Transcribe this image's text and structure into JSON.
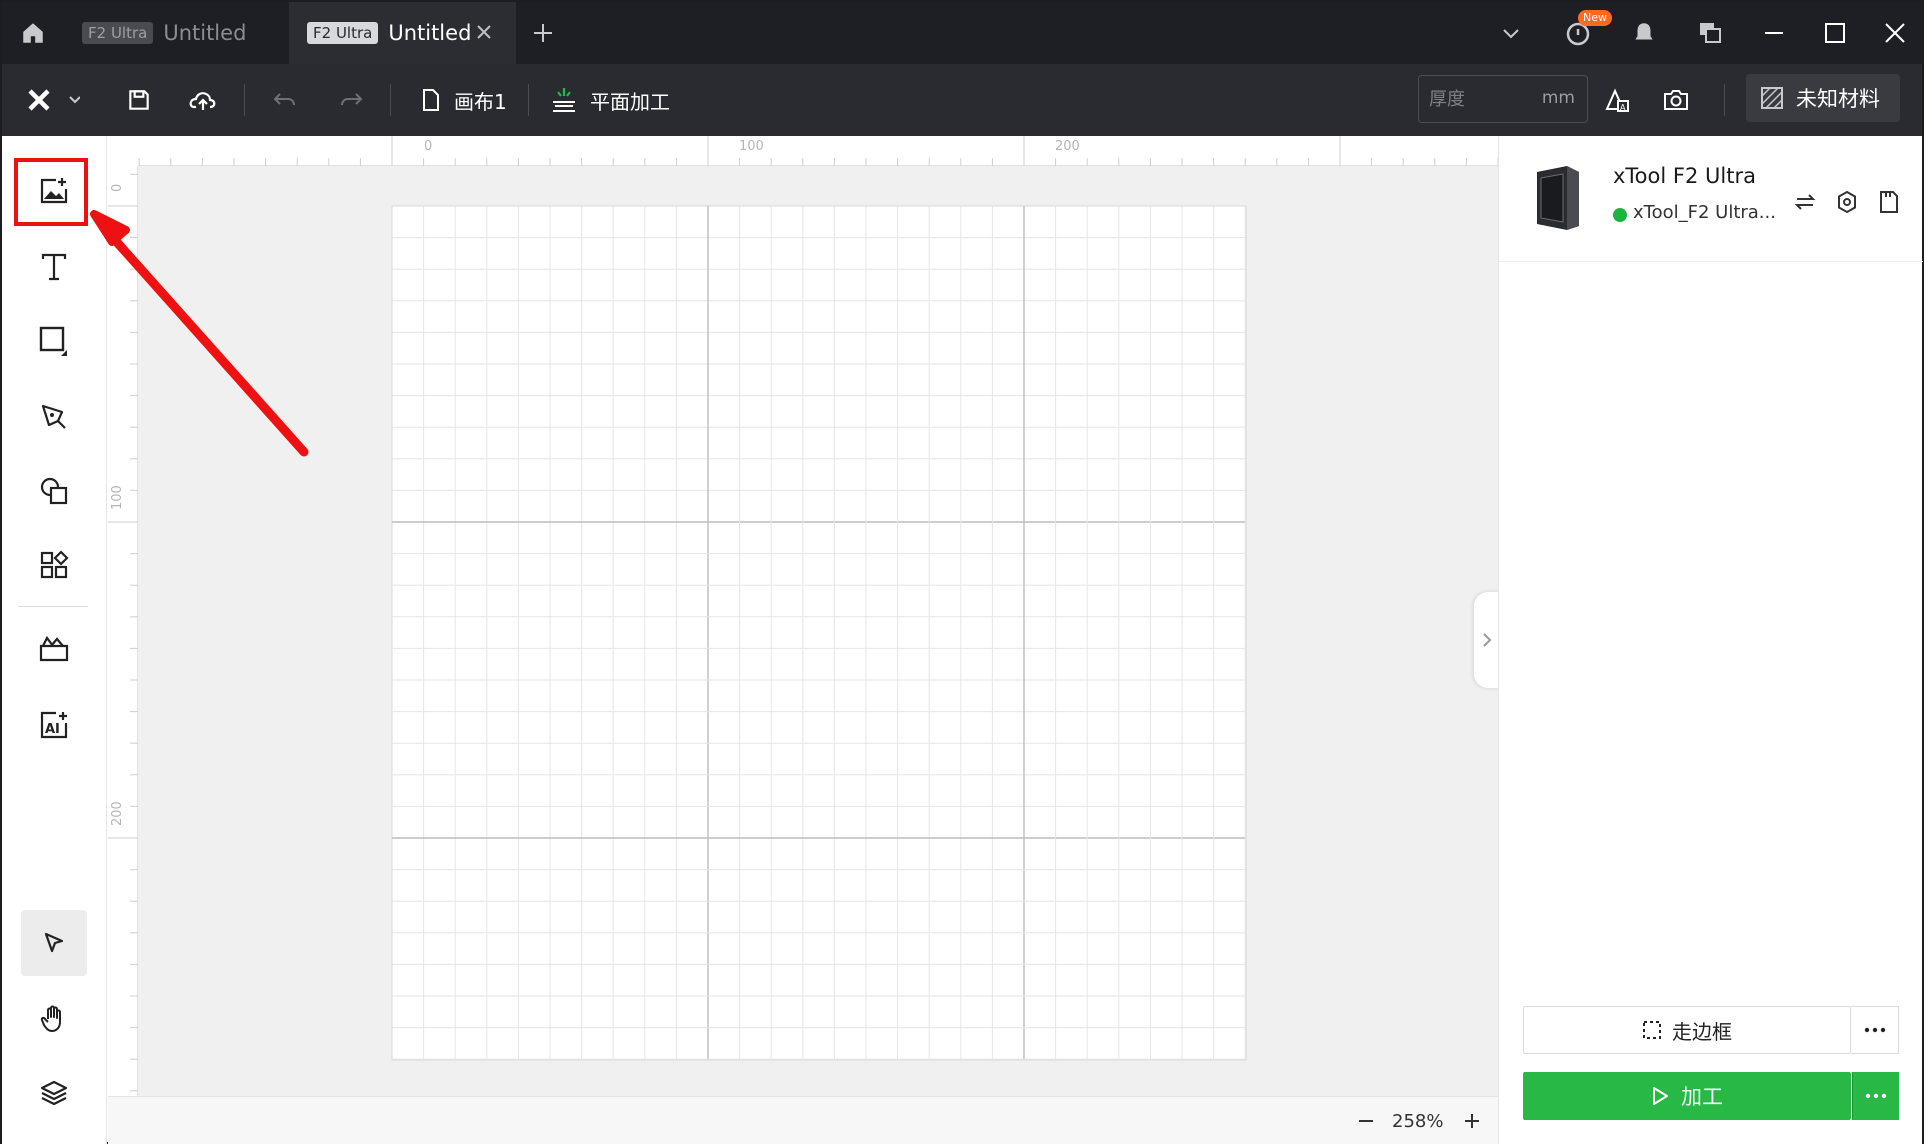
{
  "titlebar": {
    "tabs": [
      {
        "chip": "F2 Ultra",
        "title": "Untitled"
      },
      {
        "chip": "F2 Ultra",
        "title": "Untitled"
      }
    ],
    "new_badge": "New",
    "icons": [
      "home-icon",
      "close-icon",
      "plus-icon",
      "chevron-down-icon",
      "timer-icon",
      "bell-icon",
      "windows-icon",
      "minimize-icon",
      "maximize-icon",
      "close-icon"
    ]
  },
  "toolbar": {
    "canvas_label": "画布1",
    "mode_label": "平面加工",
    "thickness_placeholder": "厚度",
    "thickness_unit": "mm",
    "material_label": "未知材料"
  },
  "sidebar": {
    "tools": [
      "image-add-icon",
      "text-icon",
      "rectangle-icon",
      "pen-icon",
      "shapes-icon",
      "apps-icon",
      "material-library-icon",
      "ai-image-icon"
    ],
    "bottom_tools": [
      "select-arrow-icon",
      "hand-icon",
      "layers-icon"
    ]
  },
  "canvas": {
    "ruler_top": [
      "0",
      "100",
      "200"
    ],
    "ruler_left": [
      "0",
      "100",
      "200"
    ],
    "zoom": "258%"
  },
  "device": {
    "name": "xTool F2 Ultra",
    "status": "xTool_F2 Ultra..."
  },
  "actions": {
    "frame_label": "走边框",
    "process_label": "加工"
  },
  "colors": {
    "accent_green": "#27b845",
    "highlight_red": "#ee1111",
    "titlebar_bg": "#1e1f24",
    "toolbar_bg": "#2a2b30"
  }
}
